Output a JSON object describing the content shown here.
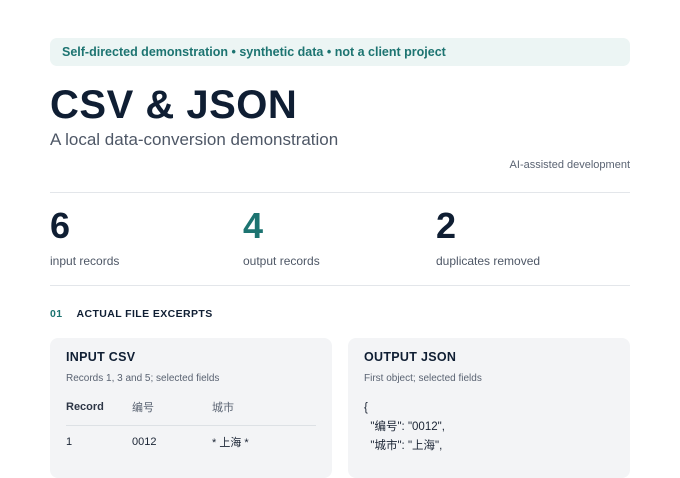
{
  "banner": "Self-directed demonstration • synthetic data • not a client project",
  "title": "CSV & JSON",
  "subtitle": "A local data-conversion demonstration",
  "ai_note": "AI-assisted development",
  "stats": [
    {
      "value": "6",
      "label": "input records",
      "color": "#0f1e33"
    },
    {
      "value": "4",
      "label": "output records",
      "color": "#1d7471"
    },
    {
      "value": "2",
      "label": "duplicates removed",
      "color": "#0f1e33"
    }
  ],
  "section": {
    "index": "01",
    "title": "ACTUAL FILE EXCERPTS"
  },
  "input_card": {
    "title": "INPUT CSV",
    "desc": "Records 1, 3 and 5; selected fields",
    "columns": [
      "Record",
      "编号",
      "城市"
    ],
    "rows": [
      [
        "1",
        "0012",
        "* 上海 *"
      ]
    ]
  },
  "output_card": {
    "title": "OUTPUT JSON",
    "desc": "First object; selected fields",
    "lines": [
      "{",
      "  \"编号\": \"0012\",",
      "  \"城市\": \"上海\","
    ]
  },
  "colors": {
    "accent": "#1d7471",
    "banner_bg": "#ecf5f4",
    "card_bg": "#f3f4f6"
  }
}
